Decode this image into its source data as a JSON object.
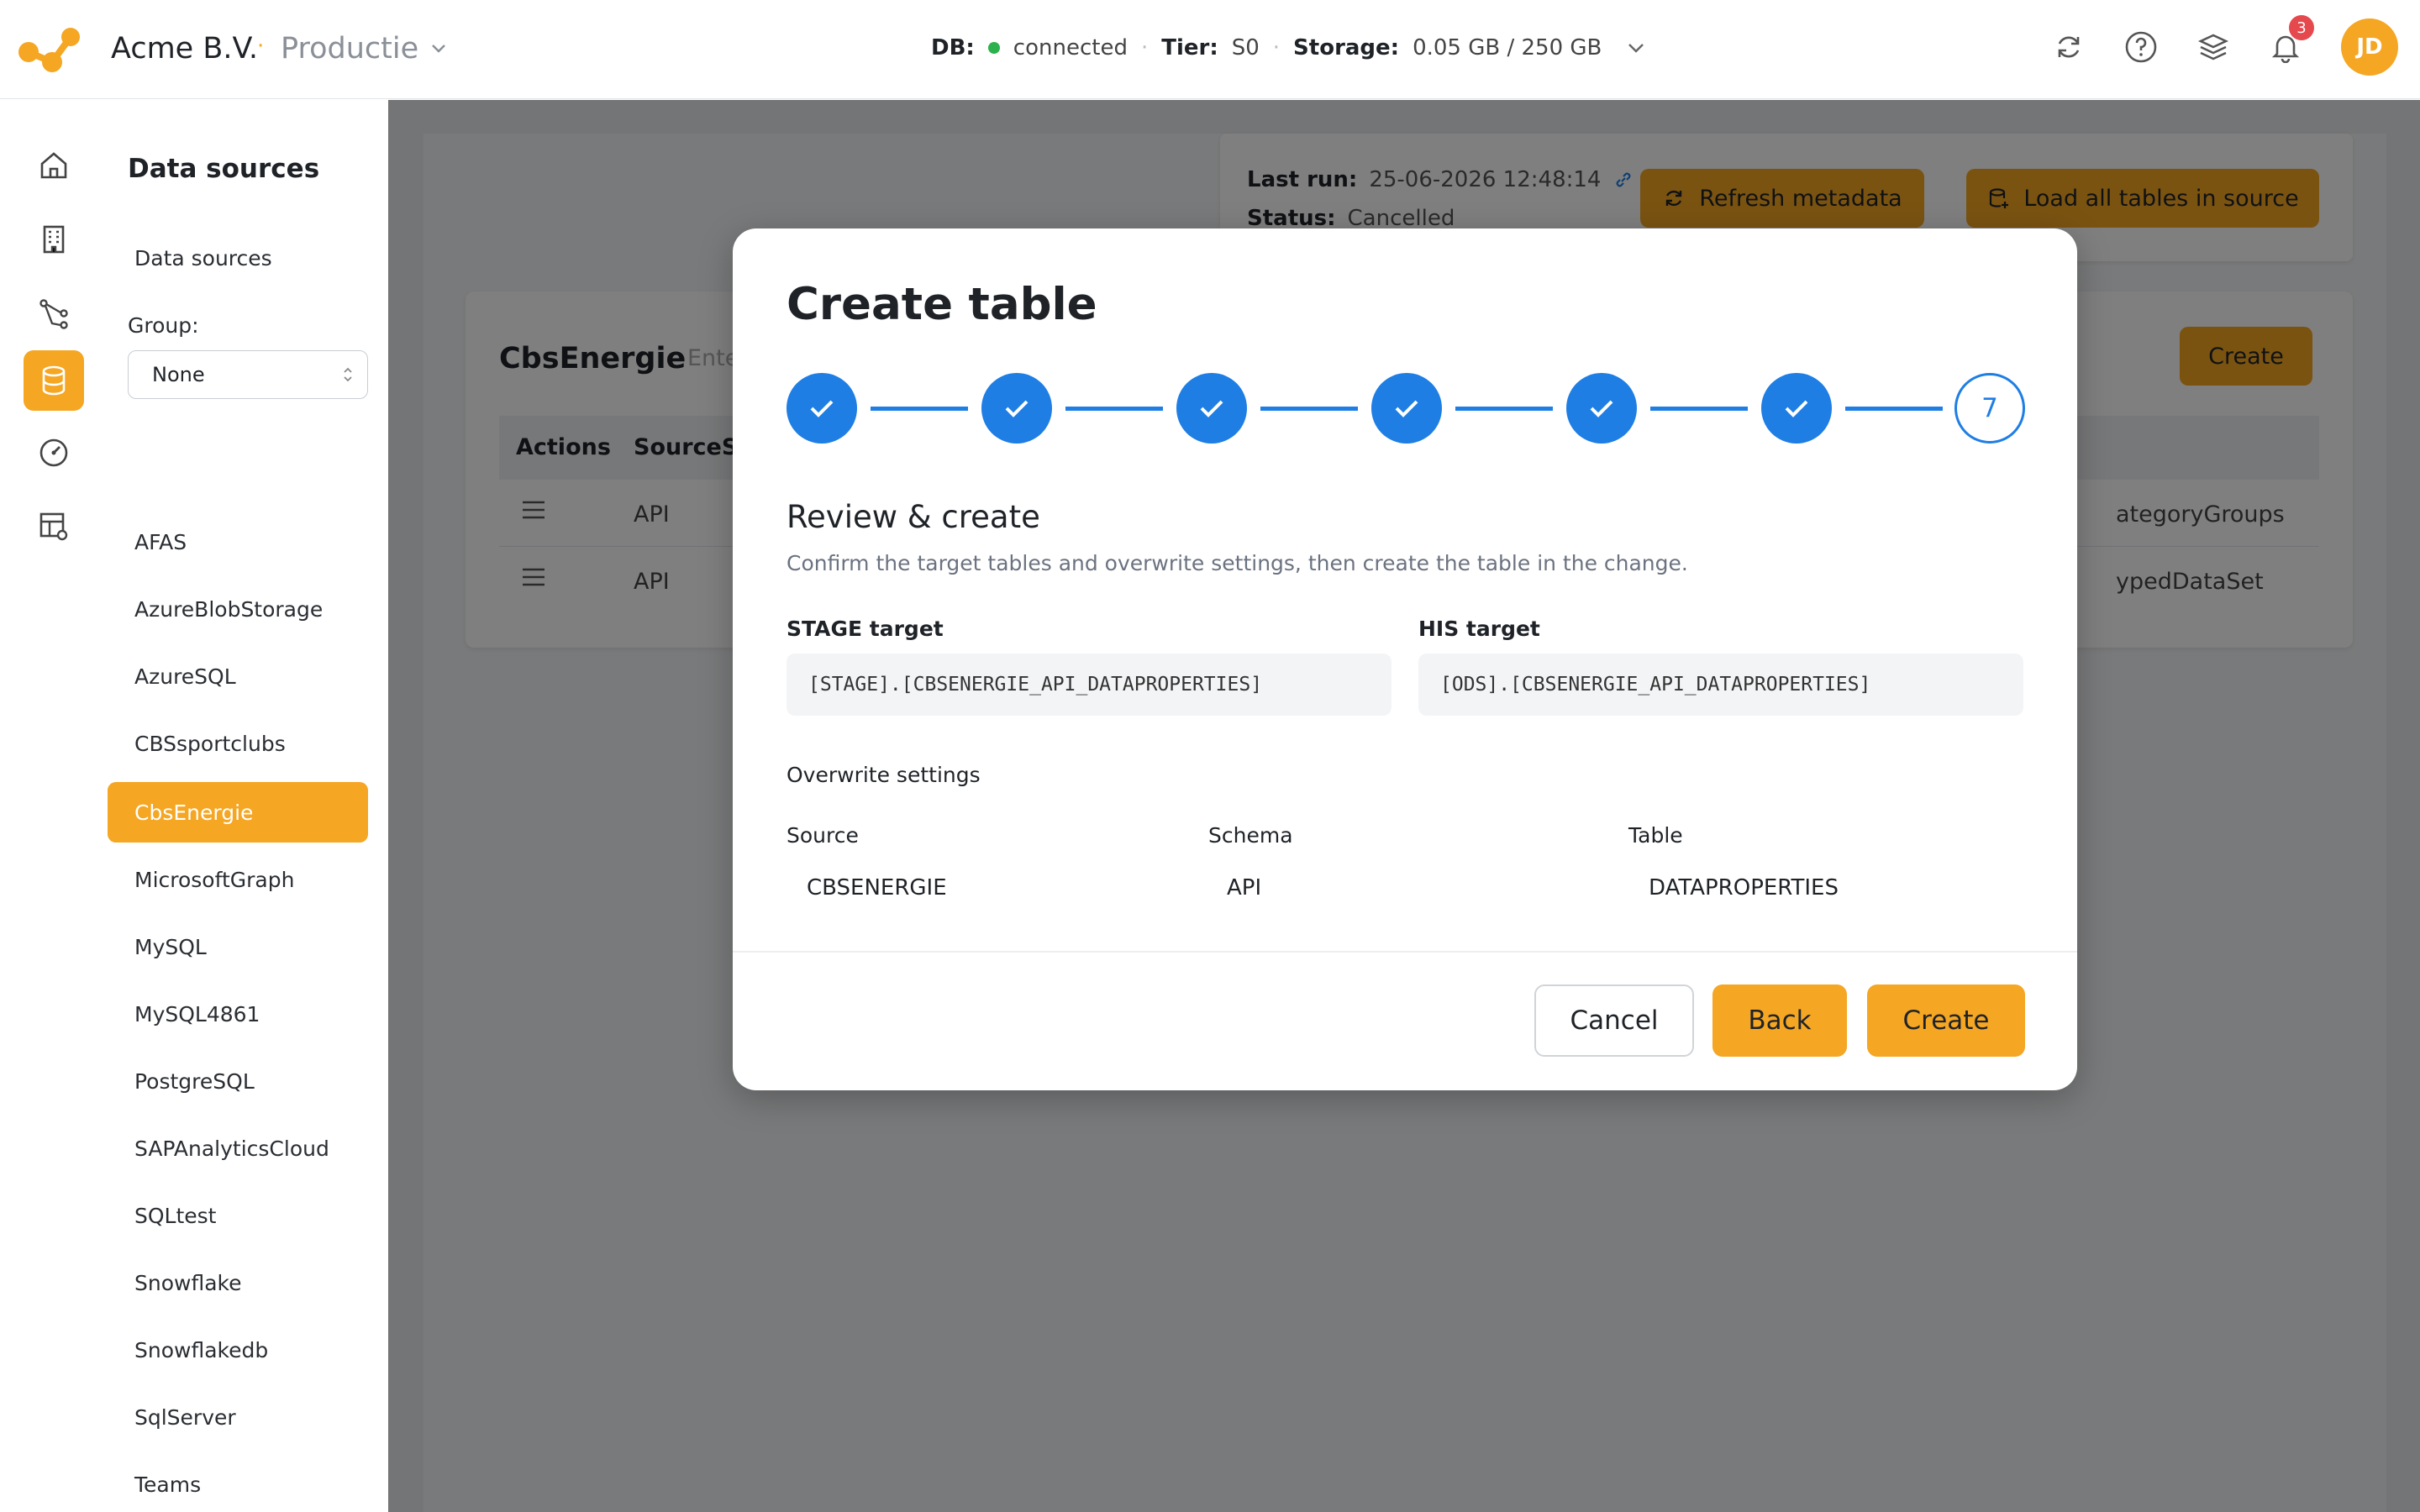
{
  "header": {
    "org_name": "Acme B.V.",
    "separator": "·",
    "environment": "Productie",
    "db_label": "DB:",
    "db_status": "connected",
    "tier_label": "Tier:",
    "tier_value": "S0",
    "storage_label": "Storage:",
    "storage_value": "0.05 GB / 250 GB",
    "notification_count": "3",
    "user_initials": "JD",
    "accent_color": "#f5a623"
  },
  "rail": {
    "icons": [
      "home-icon",
      "building-icon",
      "flow-icon",
      "database-icon",
      "gauge-icon",
      "table-settings-icon"
    ],
    "active": "database-icon"
  },
  "sidebar": {
    "title": "Data sources",
    "subtitle": "Data sources",
    "group_label": "Group:",
    "group_value": "None",
    "items": [
      "AFAS",
      "AzureBlobStorage",
      "AzureSQL",
      "CBSsportclubs",
      "CbsEnergie",
      "MicrosoftGraph",
      "MySQL",
      "MySQL4861",
      "PostgreSQL",
      "SAPAnalyticsCloud",
      "SQLtest",
      "Snowflake",
      "Snowflakedb",
      "SqlServer",
      "Teams"
    ],
    "active_item": "CbsEnergie"
  },
  "background": {
    "last_run_label": "Last run:",
    "last_run_value": "25-06-2026 12:48:14",
    "status_label": "Status:",
    "status_value": "Cancelled",
    "refresh_button": "Refresh metadata",
    "load_button": "Load all tables in source",
    "source_title": "CbsEnergie",
    "filter_placeholder": "Ente",
    "create_button": "Create",
    "table_headers": [
      "Actions",
      "SourceSc"
    ],
    "rows": [
      {
        "schema": "API",
        "tail": "ategoryGroups"
      },
      {
        "schema": "API",
        "tail": "ypedDataSet"
      }
    ]
  },
  "modal": {
    "title": "Create table",
    "steps_completed": 6,
    "current_step": "7",
    "section_title": "Review & create",
    "description": "Confirm the target tables and overwrite settings, then create the table in the change.",
    "stage_label": "STAGE target",
    "stage_value": "[STAGE].[CBSENERGIE_API_DATAPROPERTIES]",
    "his_label": "HIS target",
    "his_value": "[ODS].[CBSENERGIE_API_DATAPROPERTIES]",
    "overwrite_title": "Overwrite settings",
    "col_source": "Source",
    "col_schema": "Schema",
    "col_table": "Table",
    "val_source": "CBSENERGIE",
    "val_schema": "API",
    "val_table": "DATAPROPERTIES",
    "cancel_button": "Cancel",
    "back_button": "Back",
    "create_button": "Create",
    "step_color": "#1e7ee4"
  }
}
